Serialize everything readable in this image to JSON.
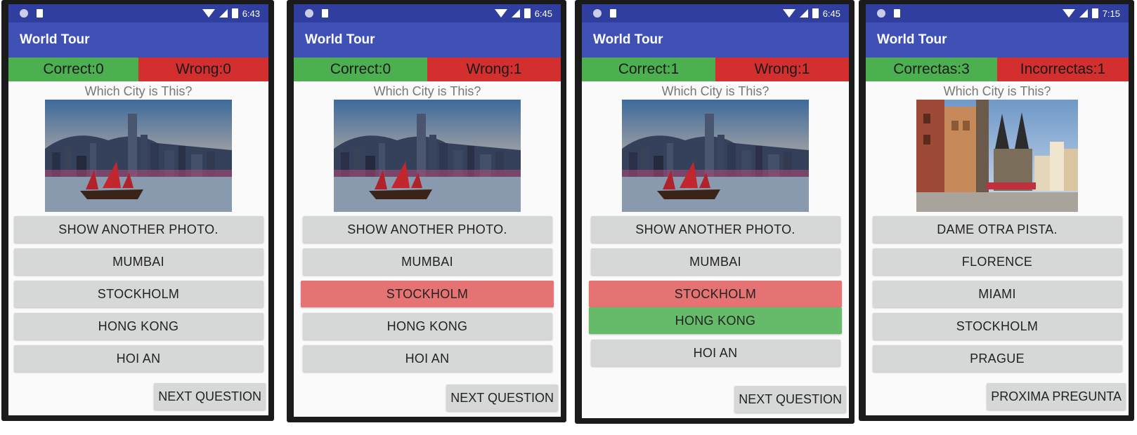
{
  "screens": [
    {
      "time": "6:43",
      "app_title": "World Tour",
      "correct_label": "Correct:0",
      "wrong_label": "Wrong:0",
      "question": "Which City is This?",
      "hint_button": "SHOW ANOTHER PHOTO.",
      "options": [
        "MUMBAI",
        "STOCKHOLM",
        "HONG KONG",
        "HOI AN"
      ],
      "next_button": "NEXT QUESTION"
    },
    {
      "time": "6:45",
      "app_title": "World Tour",
      "correct_label": "Correct:0",
      "wrong_label": "Wrong:1",
      "question": "Which City is This?",
      "hint_button": "SHOW ANOTHER PHOTO.",
      "options": [
        "MUMBAI",
        "STOCKHOLM",
        "HONG KONG",
        "HOI AN"
      ],
      "next_button": "NEXT QUESTION"
    },
    {
      "time": "6:45",
      "app_title": "World Tour",
      "correct_label": "Correct:1",
      "wrong_label": "Wrong:1",
      "question": "Which City is This?",
      "hint_button": "SHOW ANOTHER PHOTO.",
      "options": [
        "MUMBAI",
        "STOCKHOLM",
        "HONG KONG",
        "HOI AN"
      ],
      "next_button": "NEXT QUESTION"
    },
    {
      "time": "7:15",
      "app_title": "World Tour",
      "correct_label": "Correctas:3",
      "wrong_label": "Incorrectas:1",
      "question": "Which City is This?",
      "hint_button": "DAME OTRA PISTA.",
      "options": [
        "FLORENCE",
        "MIAMI",
        "STOCKHOLM",
        "PRAGUE"
      ],
      "next_button": "PROXIMA PREGUNTA"
    }
  ],
  "colors": {
    "status_bar": "#303f9f",
    "app_bar": "#3f51b5",
    "correct_bg": "#4caf50",
    "wrong_bg": "#d32f2f",
    "answer_wrong": "#e57373",
    "answer_right": "#66bb6a",
    "button_bg": "#d6d7d7"
  },
  "icons": [
    "notification-dot-icon",
    "sd-card-icon",
    "wifi-icon",
    "cell-signal-icon",
    "battery-icon"
  ]
}
